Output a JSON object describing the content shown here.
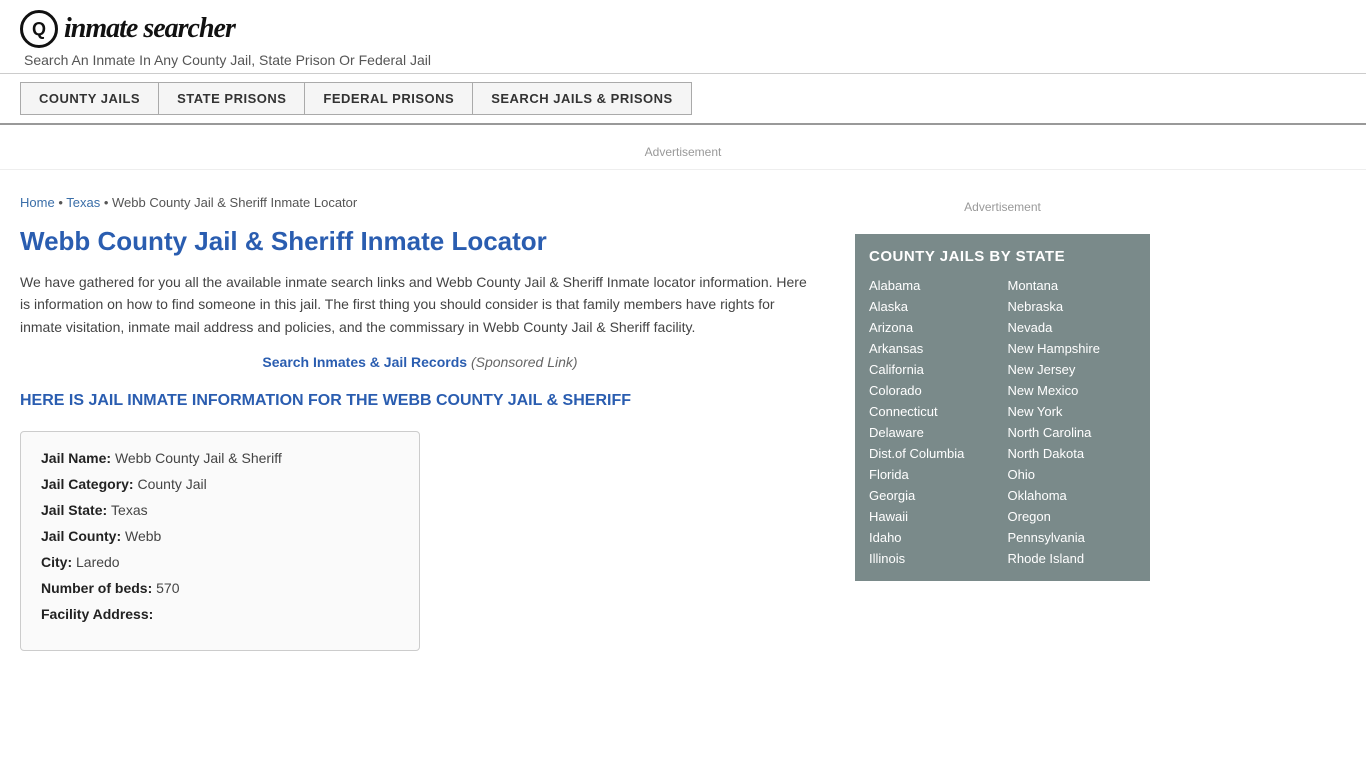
{
  "header": {
    "logo_icon": "🔍",
    "logo_text": "inmate searcher",
    "tagline": "Search An Inmate In Any County Jail, State Prison Or Federal Jail"
  },
  "nav": {
    "items": [
      {
        "label": "COUNTY JAILS",
        "href": "#"
      },
      {
        "label": "STATE PRISONS",
        "href": "#"
      },
      {
        "label": "FEDERAL PRISONS",
        "href": "#"
      },
      {
        "label": "SEARCH JAILS & PRISONS",
        "href": "#"
      }
    ]
  },
  "breadcrumb": {
    "home_label": "Home",
    "separator": " • ",
    "state_label": "Texas",
    "page_title_short": "Webb County Jail & Sheriff Inmate Locator"
  },
  "main": {
    "page_title": "Webb County Jail & Sheriff Inmate Locator",
    "description": "We have gathered for you all the available inmate search links and Webb County Jail & Sheriff Inmate locator information. Here is information on how to find someone in this jail. The first thing you should consider is that family members have rights for inmate visitation, inmate mail address and policies, and the commissary in Webb County Jail & Sheriff facility.",
    "search_link_text": "Search Inmates & Jail Records",
    "sponsored_text": "(Sponsored Link)",
    "inmate_heading": "HERE IS JAIL INMATE INFORMATION FOR THE WEBB COUNTY JAIL & SHERIFF",
    "info_fields": [
      {
        "label": "Jail Name:",
        "value": "Webb County Jail & Sheriff"
      },
      {
        "label": "Jail Category:",
        "value": "County Jail"
      },
      {
        "label": "Jail State:",
        "value": "Texas"
      },
      {
        "label": "Jail County:",
        "value": "Webb"
      },
      {
        "label": "City:",
        "value": "Laredo"
      },
      {
        "label": "Number of beds:",
        "value": "570"
      },
      {
        "label": "Facility Address:",
        "value": ""
      }
    ]
  },
  "sidebar": {
    "ad_label": "Advertisement",
    "county_jails_title": "COUNTY JAILS BY STATE",
    "states": [
      {
        "name": "Alabama",
        "href": "#"
      },
      {
        "name": "Montana",
        "href": "#"
      },
      {
        "name": "Alaska",
        "href": "#"
      },
      {
        "name": "Nebraska",
        "href": "#"
      },
      {
        "name": "Arizona",
        "href": "#"
      },
      {
        "name": "Nevada",
        "href": "#"
      },
      {
        "name": "Arkansas",
        "href": "#"
      },
      {
        "name": "New Hampshire",
        "href": "#"
      },
      {
        "name": "California",
        "href": "#"
      },
      {
        "name": "New Jersey",
        "href": "#"
      },
      {
        "name": "Colorado",
        "href": "#"
      },
      {
        "name": "New Mexico",
        "href": "#"
      },
      {
        "name": "Connecticut",
        "href": "#"
      },
      {
        "name": "New York",
        "href": "#"
      },
      {
        "name": "Delaware",
        "href": "#"
      },
      {
        "name": "North Carolina",
        "href": "#"
      },
      {
        "name": "Dist.of Columbia",
        "href": "#"
      },
      {
        "name": "North Dakota",
        "href": "#"
      },
      {
        "name": "Florida",
        "href": "#"
      },
      {
        "name": "Ohio",
        "href": "#"
      },
      {
        "name": "Georgia",
        "href": "#"
      },
      {
        "name": "Oklahoma",
        "href": "#"
      },
      {
        "name": "Hawaii",
        "href": "#"
      },
      {
        "name": "Oregon",
        "href": "#"
      },
      {
        "name": "Idaho",
        "href": "#"
      },
      {
        "name": "Pennsylvania",
        "href": "#"
      },
      {
        "name": "Illinois",
        "href": "#"
      },
      {
        "name": "Rhode Island",
        "href": "#"
      }
    ]
  },
  "ad_label": "Advertisement"
}
